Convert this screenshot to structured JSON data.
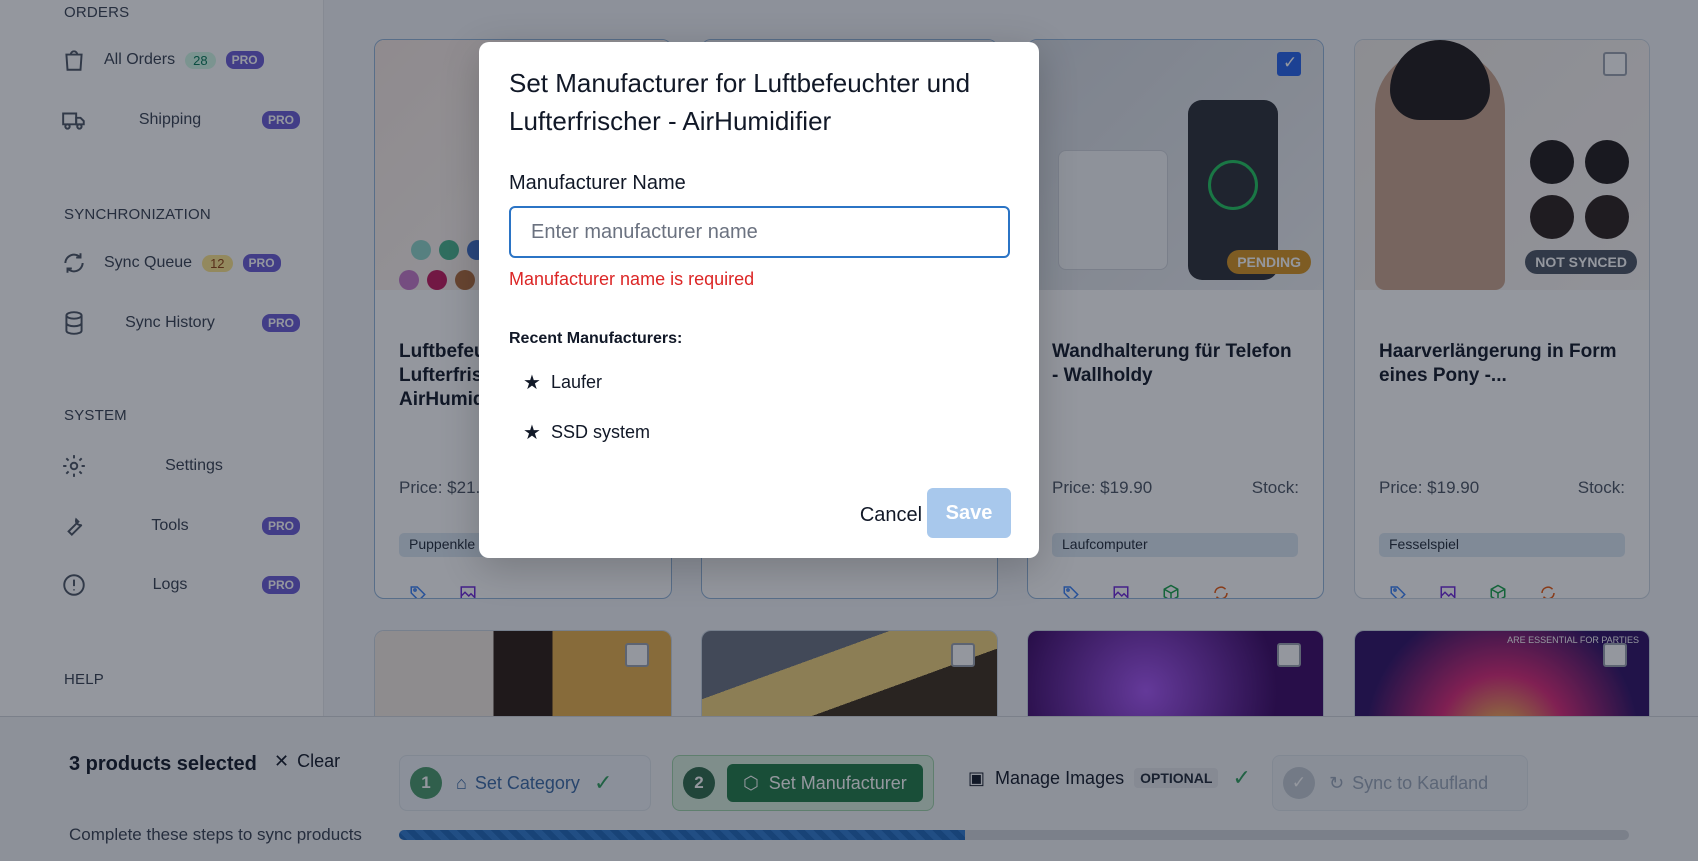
{
  "sidebar": {
    "orders_title": "ORDERS",
    "all_orders": {
      "label": "All Orders",
      "count": "28",
      "pro": "PRO"
    },
    "shipping": {
      "label": "Shipping",
      "pro": "PRO"
    },
    "sync_title": "SYNCHRONIZATION",
    "sync_queue": {
      "label": "Sync Queue",
      "count": "12",
      "pro": "PRO"
    },
    "sync_history": {
      "label": "Sync History",
      "pro": "PRO"
    },
    "system_title": "SYSTEM",
    "settings": {
      "label": "Settings"
    },
    "tools": {
      "label": "Tools",
      "pro": "PRO"
    },
    "logs": {
      "label": "Logs",
      "pro": "PRO"
    },
    "help_title": "HELP"
  },
  "cards": [
    {
      "title": "Luftbefeuchter und Lufterfrischer - AirHumidifier",
      "price": "Price: $21.",
      "category": "Puppenkle",
      "selected": true
    },
    {
      "title": "",
      "price": "",
      "category": "",
      "selected": true
    },
    {
      "title": "Wandhalterung für Telefon - Wallholdy",
      "price": "Price: $19.90",
      "stock": "Stock:",
      "category": "Laufcomputer",
      "status": "PENDING",
      "selected": true
    },
    {
      "title": "Haarverlängerung in Form eines Pony -...",
      "price": "Price: $19.90",
      "stock": "Stock:",
      "category": "Fesselspiel",
      "status": "NOT SYNCED",
      "selected": false
    }
  ],
  "bottom_image_text": "ARE ESSENTIAL FOR PARTIES",
  "modal": {
    "title": "Set Manufacturer for Luftbefeuchter und Lufterfrischer - AirHumidifier",
    "field_label": "Manufacturer Name",
    "input_value": "",
    "input_placeholder": "Enter manufacturer name",
    "error": "Manufacturer name is required",
    "recent_title": "Recent Manufacturers:",
    "recent": [
      "Laufer",
      "SSD system"
    ],
    "cancel": "Cancel",
    "save": "Save"
  },
  "bottombar": {
    "selected_text": "3 products selected",
    "clear": "Clear",
    "helper": "Complete these steps to sync products",
    "step1": {
      "num": "1",
      "label": "Set Category"
    },
    "step2": {
      "num": "2",
      "label": "Set Manufacturer"
    },
    "manage_images": {
      "label": "Manage Images",
      "tag": "OPTIONAL"
    },
    "sync": {
      "label": "Sync to Kaufland"
    },
    "progress_fraction": 0.46
  },
  "colors": {
    "primary": "#2b74c5",
    "error": "#dc2626",
    "green": "#1f7a45",
    "pending": "#d8941f"
  }
}
